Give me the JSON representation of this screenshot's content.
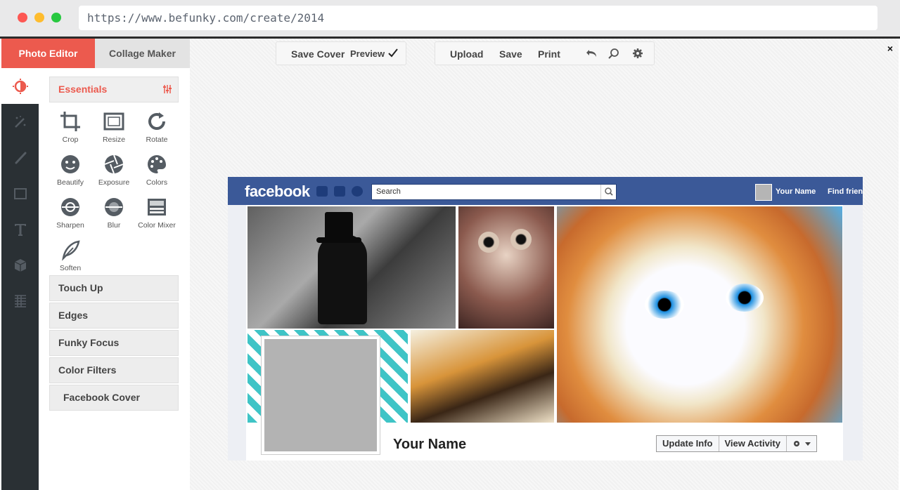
{
  "browser": {
    "url": "https://www.befunky.com/create/2014"
  },
  "tabs": [
    {
      "label": "Photo Editor"
    },
    {
      "label": "Collage Maker"
    }
  ],
  "toolbar_left": {
    "save_cover": "Save Cover",
    "preview": "Preview"
  },
  "toolbar_right": {
    "upload": "Upload",
    "save": "Save",
    "print": "Print"
  },
  "close_label": "×",
  "panel": {
    "essentials": "Essentials",
    "tools": [
      {
        "label": "Crop"
      },
      {
        "label": "Resize"
      },
      {
        "label": "Rotate"
      },
      {
        "label": "Beautify"
      },
      {
        "label": "Exposure"
      },
      {
        "label": "Colors"
      },
      {
        "label": "Sharpen"
      },
      {
        "label": "Blur"
      },
      {
        "label": "Color Mixer"
      },
      {
        "label": "Soften"
      }
    ],
    "sections": [
      {
        "label": "Touch Up"
      },
      {
        "label": "Edges"
      },
      {
        "label": "Funky Focus"
      },
      {
        "label": "Color Filters"
      },
      {
        "label": "Facebook Cover"
      }
    ]
  },
  "facebook": {
    "logo": "facebook",
    "search_placeholder": "Search",
    "user_name": "Your Name",
    "find_friends": "Find frien",
    "profile_name": "Your Name",
    "update_info": "Update Info",
    "view_activity": "View Activity"
  },
  "colors": {
    "accent": "#ec5a4e",
    "rail": "#2a3034",
    "facebook": "#3b5998"
  }
}
